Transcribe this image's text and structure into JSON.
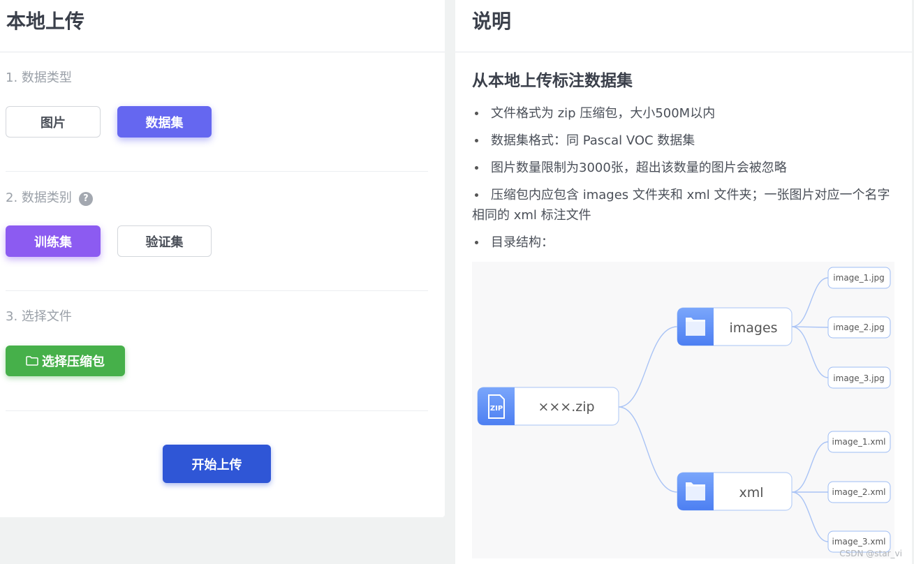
{
  "left": {
    "title": "本地上传",
    "step1": {
      "label": "1. 数据类型",
      "options": [
        "图片",
        "数据集"
      ],
      "selected": "数据集"
    },
    "step2": {
      "label": "2. 数据类别",
      "help": "?",
      "options": [
        "训练集",
        "验证集"
      ],
      "selected": "训练集"
    },
    "step3": {
      "label": "3. 选择文件",
      "button": "选择压缩包"
    },
    "submit": "开始上传"
  },
  "right": {
    "title": "说明",
    "subtitle": "从本地上传标注数据集",
    "items": [
      "文件格式为 zip 压缩包，大小500M以内",
      "数据集格式：同 Pascal VOC 数据集",
      "图片数量限制为3000张，超出该数量的图片会被忽略",
      "压缩包内应包含 images 文件夹和 xml 文件夹；一张图片对应一个名字相同的 xml 标注文件",
      "目录结构："
    ],
    "tree": {
      "root": "×××.zip",
      "root_icon_text": "ZIP",
      "folders": [
        {
          "name": "images",
          "files": [
            "image_1.jpg",
            "image_2.jpg",
            "image_3.jpg"
          ]
        },
        {
          "name": "xml",
          "files": [
            "image_1.xml",
            "image_2.xml",
            "image_3.xml"
          ]
        }
      ]
    },
    "watermark": "CSDN @star_vi"
  },
  "colors": {
    "primary_indigo": "#6567f0",
    "primary_purple": "#8c5bf1",
    "success_green": "#46b04a",
    "action_blue": "#2f56d6",
    "tree_node_blue": "#5b8ef5"
  }
}
